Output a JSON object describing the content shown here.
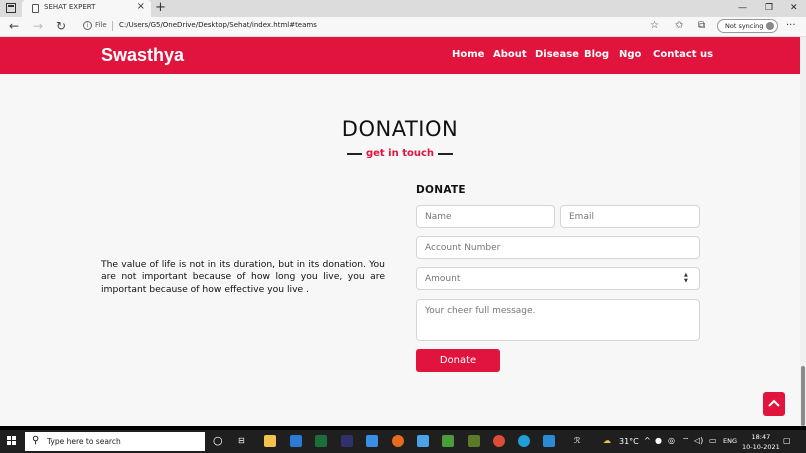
{
  "browser": {
    "tab_title": "SEHAT EXPERT",
    "file_label": "File",
    "url": "C:/Users/G5/OneDrive/Desktop/Sehat/index.html#teams",
    "sync_label": "Not syncing"
  },
  "navbar": {
    "brand": "Swasthya",
    "links": [
      "Home",
      "About",
      "Disease",
      "Blog",
      "Ngo",
      "Contact us"
    ]
  },
  "section": {
    "title": "DONATION",
    "subtitle": "get in touch"
  },
  "quote": "The value of life is not in its duration, but in its donation. You are not important because of how long you live, you are important because of how effective you live .",
  "form": {
    "title": "DONATE",
    "name_placeholder": "Name",
    "email_placeholder": "Email",
    "account_placeholder": "Account Number",
    "amount_placeholder": "Amount",
    "message_placeholder": "Your cheer full message.",
    "submit_label": "Donate"
  },
  "taskbar": {
    "search_placeholder": "Type here to search",
    "temperature": "31°C",
    "language": "ENG",
    "time": "18:47",
    "date": "10-10-2021"
  },
  "colors": {
    "brand_red": "#e0143c",
    "background": "#f7f7f7"
  }
}
